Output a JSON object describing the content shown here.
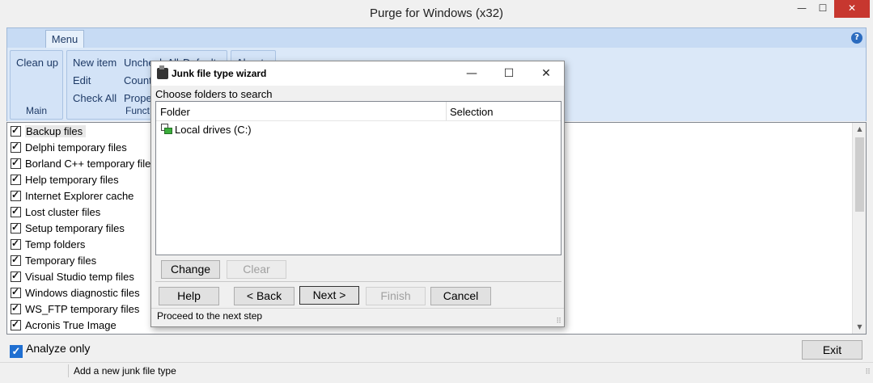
{
  "window": {
    "title": "Purge for Windows (x32)",
    "min": "—",
    "max": "☐",
    "close": "✕"
  },
  "ribbon": {
    "tab": "Menu",
    "help": "?",
    "groups": {
      "main": {
        "label": "Main",
        "cleanup": "Clean up"
      },
      "functions": {
        "label": "Funct",
        "new_item": "New item",
        "edit": "Edit",
        "check_all": "Check All",
        "uncheck_all": "Uncheck All",
        "count": "Count",
        "prope": "Prope",
        "defaults": "Defaults"
      },
      "about": {
        "label": "About"
      }
    }
  },
  "list": {
    "items": [
      {
        "label": "Backup files",
        "checked": true,
        "selected": true
      },
      {
        "label": "Delphi temporary files",
        "checked": true
      },
      {
        "label": "Borland C++ temporary file",
        "checked": true
      },
      {
        "label": "Help temporary files",
        "checked": true
      },
      {
        "label": "Internet Explorer cache",
        "checked": true
      },
      {
        "label": "Lost cluster files",
        "checked": true
      },
      {
        "label": "Setup temporary files",
        "checked": true
      },
      {
        "label": "Temp folders",
        "checked": true
      },
      {
        "label": "Temporary files",
        "checked": true
      },
      {
        "label": "Visual Studio temp files",
        "checked": true
      },
      {
        "label": "Windows diagnostic files",
        "checked": true
      },
      {
        "label": "WS_FTP temporary files",
        "checked": true
      },
      {
        "label": "Acronis True Image",
        "checked": true
      }
    ]
  },
  "analyze": {
    "label": "Analyze only",
    "checked": true
  },
  "exit_label": "Exit",
  "status": {
    "text": "Add a new junk file type"
  },
  "dialog": {
    "title": "Junk file type wizard",
    "min": "—",
    "max": "☐",
    "close": "✕",
    "subtitle": "Choose folders to search",
    "columns": {
      "folder": "Folder",
      "selection": "Selection"
    },
    "rows": [
      {
        "folder": "Local drives (C:)",
        "selection": ""
      }
    ],
    "buttons": {
      "change": "Change",
      "clear": "Clear",
      "help": "Help",
      "back": "< Back",
      "next": "Next >",
      "finish": "Finish",
      "cancel": "Cancel"
    },
    "status": "Proceed to the next step"
  }
}
